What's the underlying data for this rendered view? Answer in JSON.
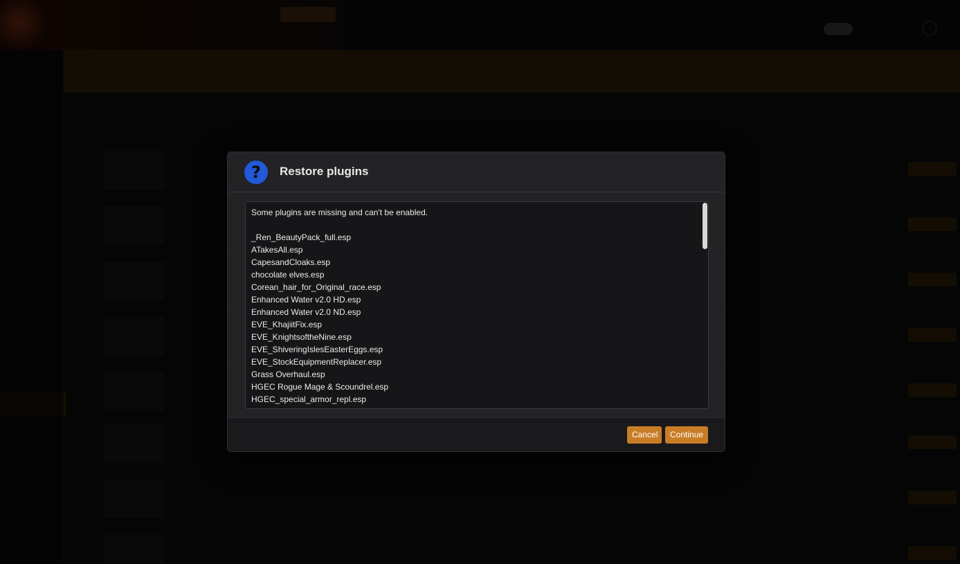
{
  "dialog": {
    "title": "Restore plugins",
    "icon": "question-icon",
    "icon_color": "#2159d6",
    "message": "Some plugins are missing and can't be enabled.",
    "plugins": [
      "_Ren_BeautyPack_full.esp",
      "ATakesAll.esp",
      "CapesandCloaks.esp",
      "chocolate elves.esp",
      "Corean_hair_for_Original_race.esp",
      "Enhanced Water v2.0 HD.esp",
      "Enhanced Water v2.0 ND.esp",
      "EVE_KhajiitFix.esp",
      "EVE_KnightsoftheNine.esp",
      "EVE_ShiveringIslesEasterEggs.esp",
      "EVE_StockEquipmentReplacer.esp",
      "Grass Overhaul.esp",
      "HGEC Rogue Mage & Scoundrel.esp",
      "HGEC_special_armor_repl.esp"
    ],
    "cancel_label": "Cancel",
    "continue_label": "Continue",
    "accent_color": "#c87d26"
  }
}
